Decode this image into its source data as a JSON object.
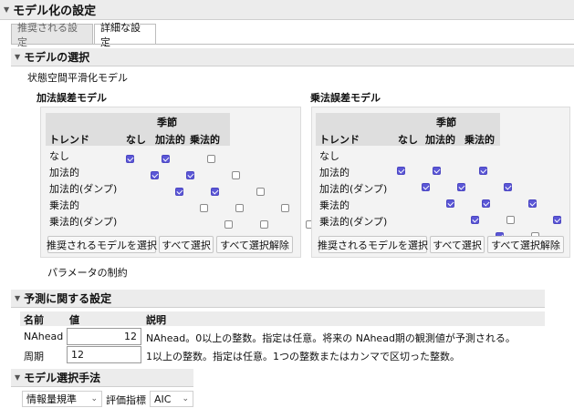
{
  "title": "モデル化の設定",
  "tabs": [
    {
      "label": "推奨される設定",
      "active": false
    },
    {
      "label": "詳細な設定",
      "active": true
    }
  ],
  "model_selection": {
    "title": "モデルの選択",
    "subtitle": "状態空間平滑化モデル",
    "additive": {
      "title": "加法誤差モデル",
      "season_header": "季節",
      "trend_header": "トレンド",
      "season_cols": [
        "なし",
        "加法的",
        "乗法的"
      ],
      "rows": [
        {
          "trend": "なし",
          "checks": [
            true,
            true,
            false
          ]
        },
        {
          "trend": "加法的",
          "checks": [
            true,
            true,
            false
          ]
        },
        {
          "trend": "加法的(ダンプ)",
          "checks": [
            true,
            true,
            false
          ]
        },
        {
          "trend": "乗法的",
          "checks": [
            false,
            false,
            false
          ]
        },
        {
          "trend": "乗法的(ダンプ)",
          "checks": [
            false,
            false,
            false
          ]
        }
      ],
      "buttons": [
        "推奨されるモデルを選択",
        "すべて選択",
        "すべて選択解除"
      ]
    },
    "multiplicative": {
      "title": "乗法誤差モデル",
      "season_header": "季節",
      "trend_header": "トレンド",
      "season_cols": [
        "なし",
        "加法的",
        "乗法的"
      ],
      "rows": [
        {
          "trend": "なし",
          "checks": [
            true,
            true,
            true
          ]
        },
        {
          "trend": "加法的",
          "checks": [
            true,
            true,
            true
          ]
        },
        {
          "trend": "加法的(ダンプ)",
          "checks": [
            true,
            true,
            true
          ]
        },
        {
          "trend": "乗法的",
          "checks": [
            true,
            false,
            true
          ]
        },
        {
          "trend": "乗法的(ダンプ)",
          "checks": [
            true,
            false,
            true
          ]
        }
      ],
      "buttons": [
        "推奨されるモデルを選択",
        "すべて選択",
        "すべて選択解除"
      ]
    },
    "param_constraint": {
      "label": "パラメータの制約",
      "checked": true
    }
  },
  "forecast": {
    "title": "予測に関する設定",
    "headers": [
      "名前",
      "値",
      "説明"
    ],
    "rows": [
      {
        "name": "NAhead",
        "value": "12",
        "align": "right",
        "desc": "NAhead。0以上の整数。指定は任意。将来の NAhead期の観測値が予測される。"
      },
      {
        "name": "周期",
        "value": "12",
        "align": "left",
        "desc": "1以上の整数。指定は任意。1つの整数またはカンマで区切った整数。"
      }
    ]
  },
  "model_method": {
    "title": "モデル選択手法",
    "criterion": "情報量規準",
    "metric_label": "評価指標",
    "metric_value": "AIC"
  },
  "icons": [
    "collapse-triangle-icon",
    "chevron-down-icon",
    "checkbox-checked-icon"
  ],
  "colors": {
    "accent": "#5b57d6",
    "header_bg": "#ececec",
    "panel_bg": "#f3f3f3"
  }
}
